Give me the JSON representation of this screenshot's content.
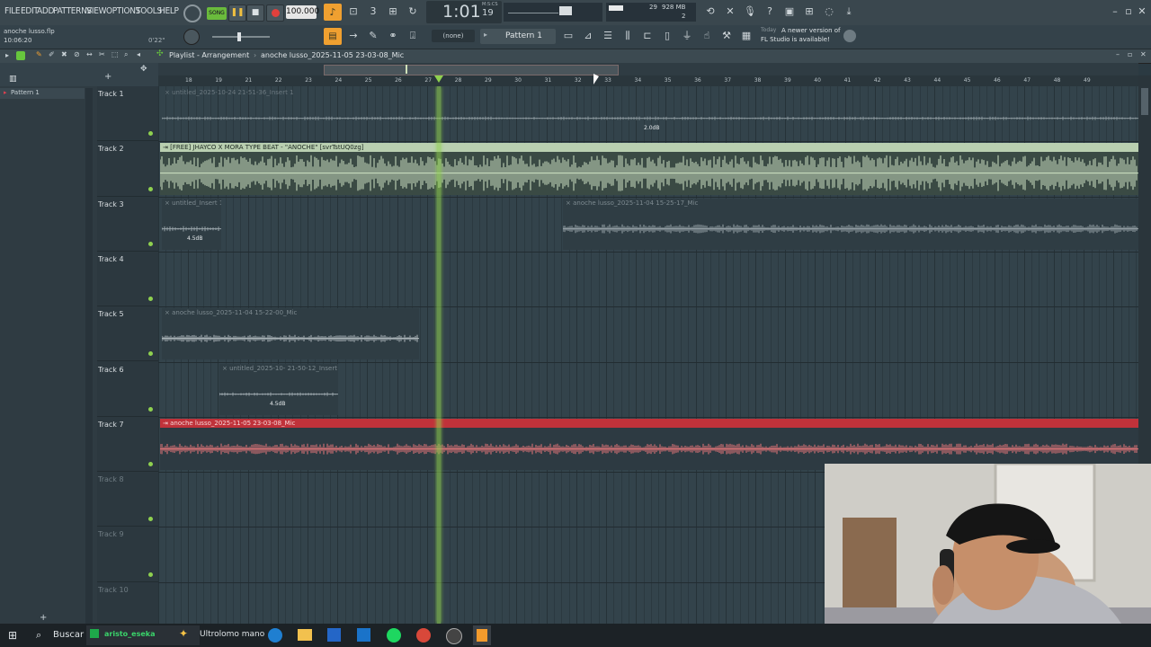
{
  "menu": [
    "FILE",
    "EDIT",
    "ADD",
    "PATTERNS",
    "VIEW",
    "OPTIONS",
    "TOOLS",
    "HELP"
  ],
  "project": {
    "file_name": "anoche lusso.flp",
    "time": "10:06:20",
    "mini_time": "0'22\""
  },
  "transport": {
    "mode": "SONG",
    "tempo": "100.000",
    "song_time": "1:01",
    "song_time_frac": "19",
    "time_label": "M:S:CS",
    "cpu": "29",
    "memory": "928 MB",
    "voices": "2"
  },
  "pattern": {
    "name": "Pattern 1",
    "snap": "(none)"
  },
  "news": {
    "line1": "Today",
    "line2": "A newer version of",
    "line3": "FL Studio is available!"
  },
  "playlist": {
    "title": "Playlist - Arrangement",
    "breadcrumb": "anoche lusso_2025-11-05 23-03-08_Mic"
  },
  "left_panel": {
    "pattern_item": "Pattern 1"
  },
  "ruler": [
    "18",
    "19",
    "21",
    "22",
    "23",
    "24",
    "25",
    "26",
    "27",
    "28",
    "29",
    "30",
    "31",
    "32",
    "33",
    "34",
    "35",
    "36",
    "37",
    "38",
    "39",
    "40",
    "41",
    "42",
    "43",
    "44",
    "45",
    "46",
    "47",
    "48",
    "49"
  ],
  "tracks": [
    "Track 1",
    "Track 2",
    "Track 3",
    "Track 4",
    "Track 5",
    "Track 6",
    "Track 7",
    "Track 8",
    "Track 9",
    "Track 10"
  ],
  "clips": {
    "c1": {
      "label": "untitled_2025-10-24 21-51-36_Insert 1",
      "gain": "2.0dB"
    },
    "c2": {
      "label": "[FREE] JHAYCO X MORA TYPE BEAT - \"ANOCHE\" [svrTstUQ0zg]"
    },
    "c3a": {
      "label": "untitled_Insert 1",
      "gain": "4.5dB"
    },
    "c3b": {
      "label": "anoche lusso_2025-11-04 15-25-17_Mic"
    },
    "c5": {
      "label": "anoche lusso_2025-11-04 15-22-00_Mic"
    },
    "c6": {
      "label": "untitled_2025-10-  21-50-12_Insert 1",
      "gain": "4.5dB"
    },
    "c7": {
      "label": "anoche lusso_2025-11-05 23-03-08_Mic"
    }
  },
  "taskbar": {
    "search": "Buscar",
    "app1": "aristo_eseka",
    "app2": "Ultrolomo mano"
  },
  "colors": {
    "accent_orange": "#f0a030",
    "clip_green": "#b9cfb0",
    "clip_red": "#c0323a",
    "playhead": "#8fd14f"
  }
}
